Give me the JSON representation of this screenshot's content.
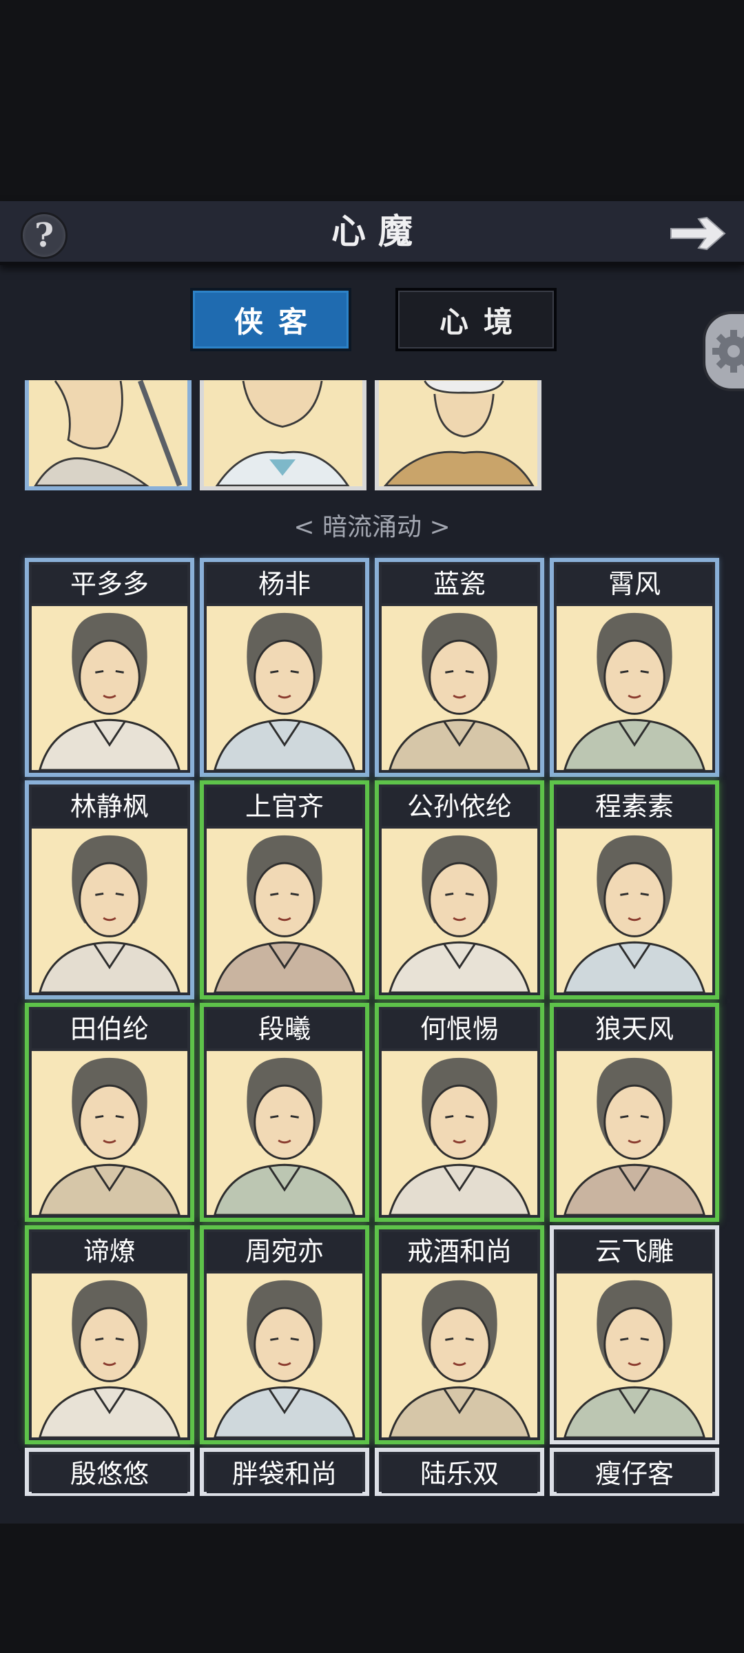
{
  "header": {
    "title": "心魔",
    "help_label": "?"
  },
  "tabs": [
    {
      "label": "侠客",
      "active": true
    },
    {
      "label": "心境",
      "active": false
    }
  ],
  "section": {
    "label": "< 暗流涌动 >"
  },
  "colors": {
    "accent_tab": "#1f6bb0",
    "border_green": "#5ec34a",
    "border_blue": "#8ab0d8",
    "portrait_bg": "#f7e6b8"
  },
  "characters": [
    {
      "name": "平多多",
      "frame": "blue"
    },
    {
      "name": "杨非",
      "frame": "blue"
    },
    {
      "name": "蓝瓷",
      "frame": "blue"
    },
    {
      "name": "霄风",
      "frame": "blue"
    },
    {
      "name": "林静枫",
      "frame": "blue"
    },
    {
      "name": "上官齐",
      "frame": "green"
    },
    {
      "name": "公孙依纶",
      "frame": "green"
    },
    {
      "name": "程素素",
      "frame": "green"
    },
    {
      "name": "田伯纶",
      "frame": "green"
    },
    {
      "name": "段曦",
      "frame": "green"
    },
    {
      "name": "何恨惕",
      "frame": "green"
    },
    {
      "name": "狼天风",
      "frame": "green"
    },
    {
      "name": "谛燎",
      "frame": "green"
    },
    {
      "name": "周宛亦",
      "frame": "green"
    },
    {
      "name": "戒酒和尚",
      "frame": "green"
    },
    {
      "name": "云飞雕",
      "frame": "white"
    },
    {
      "name": "殷悠悠",
      "frame": "white"
    },
    {
      "name": "胖袋和尚",
      "frame": "white"
    },
    {
      "name": "陆乐双",
      "frame": "white"
    },
    {
      "name": "瘦仔客",
      "frame": "white"
    }
  ]
}
